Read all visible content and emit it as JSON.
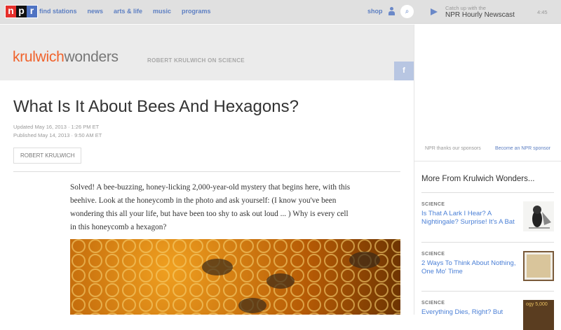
{
  "nav": {
    "logo": [
      "n",
      "p",
      "r"
    ],
    "items": [
      "find stations",
      "news",
      "arts & life",
      "music",
      "programs"
    ],
    "shop": "shop"
  },
  "player": {
    "catch": "Catch up with the",
    "title": "NPR Hourly Newscast",
    "time": "4:45"
  },
  "banner": {
    "brand1": "krulwich",
    "brand2": "wonders",
    "tagline": "ROBERT KRULWICH ON SCIENCE",
    "fb": "f"
  },
  "article": {
    "title": "What Is It About Bees And Hexagons?",
    "updated": "Updated May 16, 2013 · 1:26 PM ET",
    "published": "Published May 14, 2013 · 9:50 AM ET",
    "byline": "ROBERT KRULWICH",
    "body": "Solved! A bee-buzzing, honey-licking 2,000-year-old mystery that begins here, with this beehive. Look at the honeycomb in the photo and ask yourself: (I know you've been wondering this all your life, but have been too shy to ask out loud ... ) Why is every cell in this honeycomb a hexagon?"
  },
  "sidebar": {
    "sponsor_thanks": "NPR thanks our sponsors",
    "sponsor_link": "Become an NPR sponsor",
    "more_title": "More From Krulwich Wonders...",
    "items": [
      {
        "category": "SCIENCE",
        "title": "Is That A Lark I Hear? A Nightingale? Surprise! It's A Bat"
      },
      {
        "category": "SCIENCE",
        "title": "2 Ways To Think About Nothing, One Mo' Time"
      },
      {
        "category": "SCIENCE",
        "title": "Everything Dies, Right? But",
        "thumb_text": "ogy 5,000"
      }
    ]
  },
  "colors": {
    "brand_orange": "#f0622b",
    "link_blue": "#4a7fd6",
    "nav_blue": "#5d7fc2"
  }
}
